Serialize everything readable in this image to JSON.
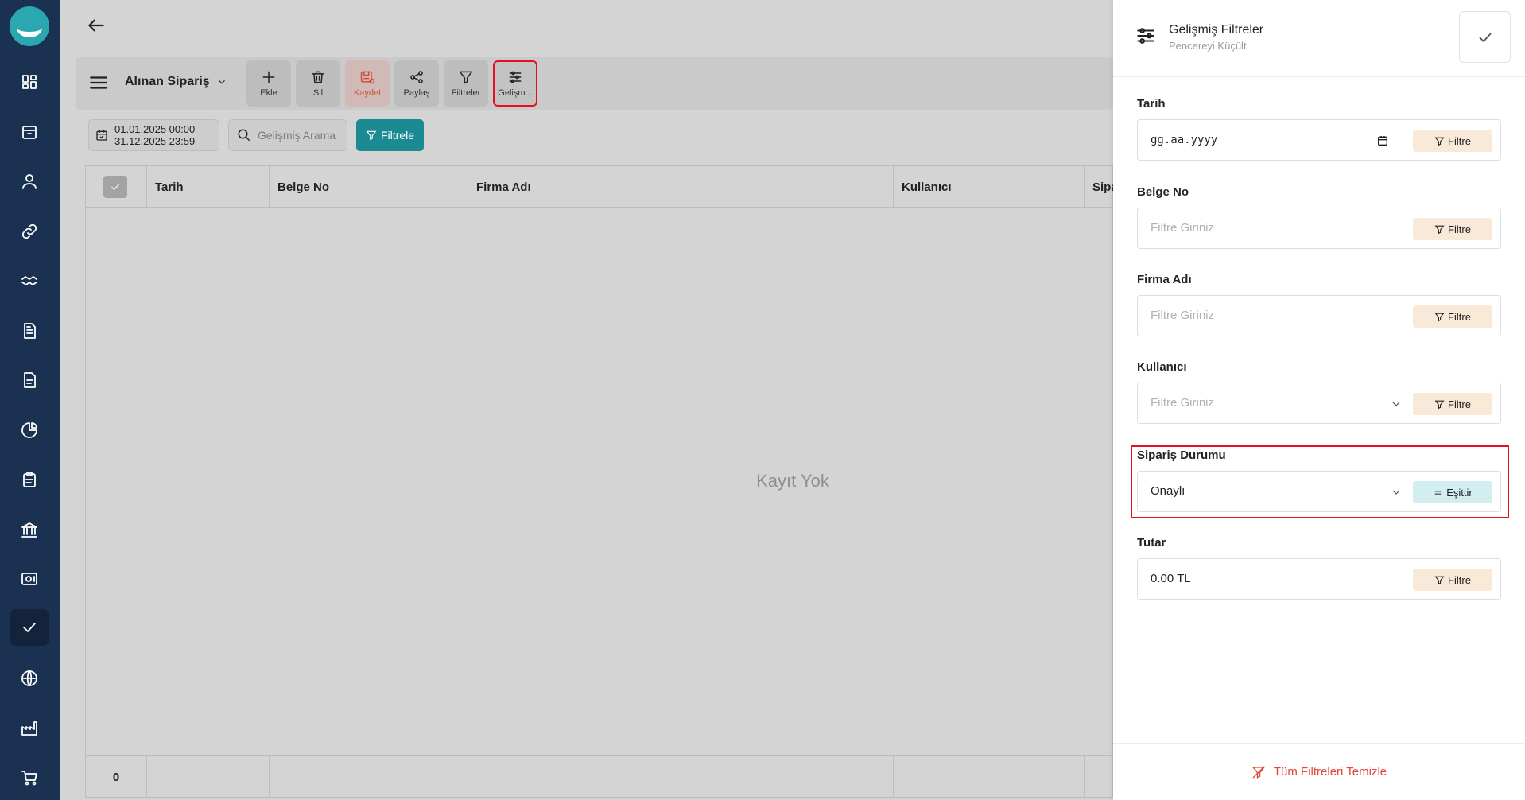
{
  "sidebar": {
    "items": [
      {
        "icon": "dashboard-icon"
      },
      {
        "icon": "box-icon"
      },
      {
        "icon": "user-icon"
      },
      {
        "icon": "link-icon"
      },
      {
        "icon": "handshake-icon"
      },
      {
        "icon": "document-icon"
      },
      {
        "icon": "file-icon"
      },
      {
        "icon": "pie-chart-icon"
      },
      {
        "icon": "clipboard-icon"
      },
      {
        "icon": "bank-icon"
      },
      {
        "icon": "safe-icon"
      },
      {
        "icon": "check-icon",
        "active": true
      },
      {
        "icon": "globe-icon"
      },
      {
        "icon": "factory-icon"
      },
      {
        "icon": "cart-icon"
      }
    ]
  },
  "toolbar": {
    "module_title": "Alınan Sipariş",
    "buttons": {
      "add": "Ekle",
      "delete": "Sil",
      "save": "Kaydet",
      "share": "Paylaş",
      "filters": "Filtreler",
      "advanced": "Gelişm..."
    }
  },
  "filter_bar": {
    "date_start": "01.01.2025 00:00",
    "date_end": "31.12.2025 23:59",
    "search_placeholder": "Gelişmiş Arama",
    "filter_button": "Filtrele"
  },
  "grid": {
    "columns": [
      "Tarih",
      "Belge No",
      "Firma Adı",
      "Kullanıcı",
      "Sipa"
    ],
    "empty_message": "Kayıt Yok",
    "footer_count": "0"
  },
  "panel": {
    "title": "Gelişmiş Filtreler",
    "subtitle": "Pencereyi Küçült",
    "fields": {
      "date": {
        "label": "Tarih",
        "value": "gg.aa.yyyy",
        "button": "Filtre"
      },
      "doc_no": {
        "label": "Belge No",
        "placeholder": "Filtre Giriniz",
        "button": "Filtre"
      },
      "company": {
        "label": "Firma Adı",
        "placeholder": "Filtre Giriniz",
        "button": "Filtre"
      },
      "user": {
        "label": "Kullanıcı",
        "placeholder": "Filtre Giriniz",
        "button": "Filtre"
      },
      "status": {
        "label": "Sipariş Durumu",
        "value": "Onaylı",
        "button": "Eşittir"
      },
      "amount": {
        "label": "Tutar",
        "value": "0.00 TL",
        "button": "Filtre"
      }
    },
    "clear_all": "Tüm Filtreleri Temizle"
  },
  "colors": {
    "sidebar": "#1b3151",
    "accent": "#1b8a92",
    "highlight": "#e3101d",
    "danger": "#e0463a"
  }
}
